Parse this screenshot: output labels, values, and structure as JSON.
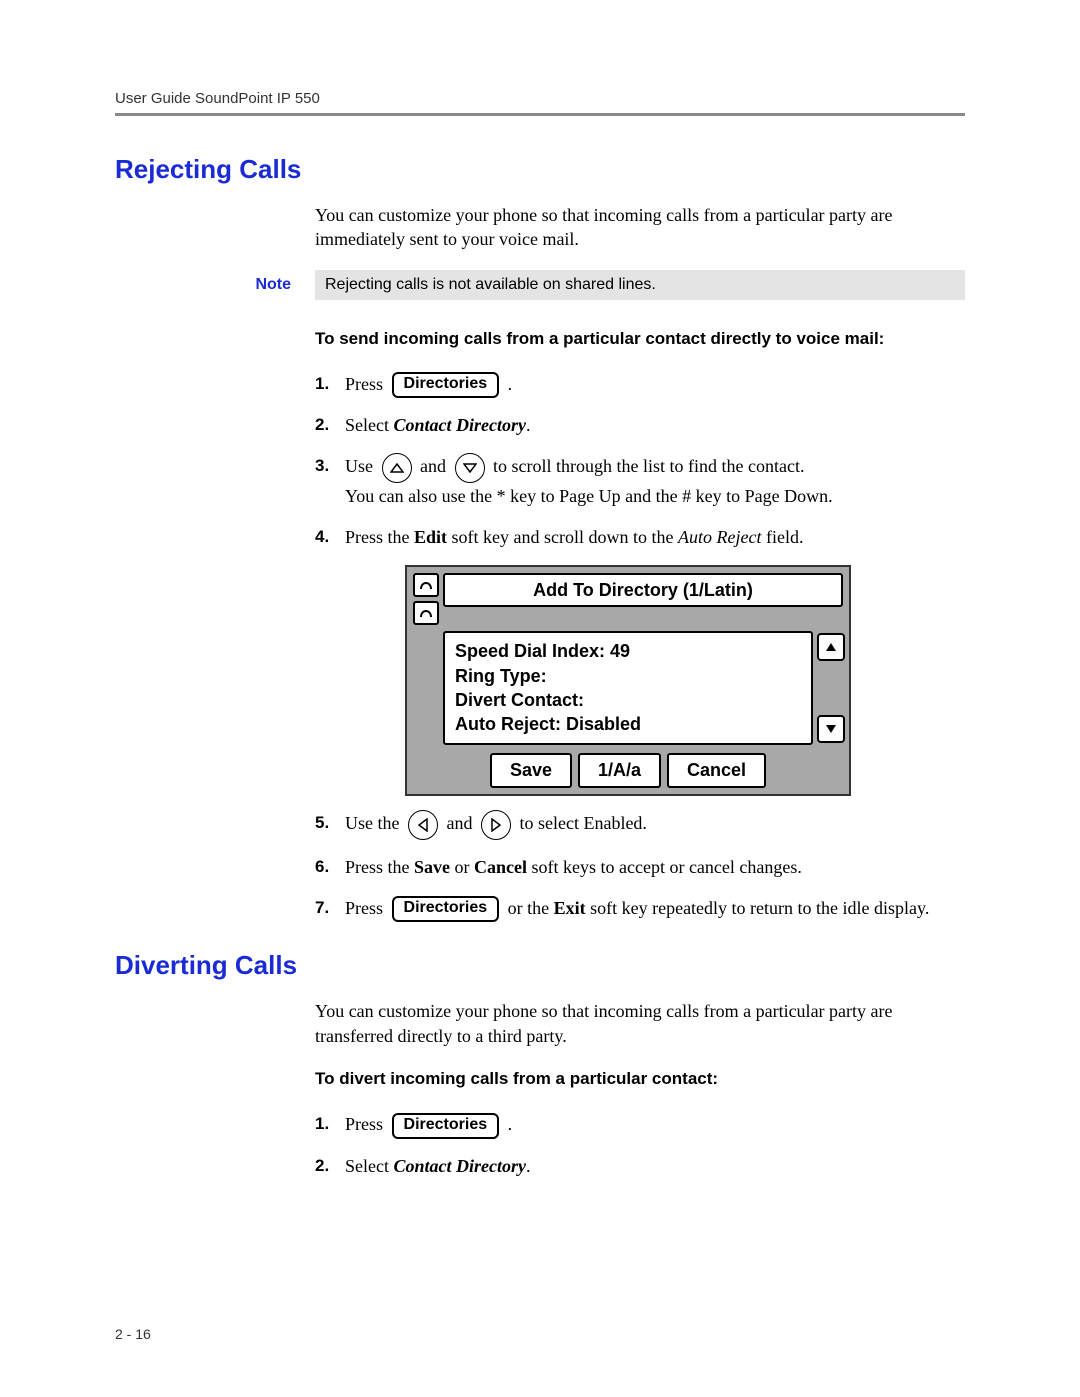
{
  "header": "User Guide SoundPoint IP 550",
  "pageNum": "2 - 16",
  "section1": {
    "title": "Rejecting Calls",
    "intro": "You can customize your phone so that incoming calls from a particular party are immediately sent to your voice mail.",
    "noteLabel": "Note",
    "noteBody": "Rejecting calls is not available on shared lines.",
    "subhead": "To send incoming calls from a particular contact directly to voice mail:",
    "step1_press": "Press ",
    "step1_btn": "Directories",
    "step1_end": " .",
    "step2_a": "Select ",
    "step2_b": "Contact Directory",
    "step2_c": ".",
    "step3_a": "Use ",
    "step3_b": " and ",
    "step3_c": " to scroll through the list to find the contact.",
    "step3_line2": "You can also use the * key to Page Up and the # key to Page Down.",
    "step4_a": "Press the ",
    "step4_b": "Edit",
    "step4_c": " soft key and scroll down to the ",
    "step4_d": "Auto Reject",
    "step4_e": " field.",
    "lcd": {
      "title": "Add To Directory (1/Latin)",
      "line1": "Speed Dial Index: 49",
      "line2": "Ring Type:",
      "line3": "Divert Contact:",
      "line4": "Auto Reject: Disabled",
      "sk1": "Save",
      "sk2": "1/A/a",
      "sk3": "Cancel"
    },
    "step5_a": "Use the ",
    "step5_b": " and ",
    "step5_c": " to select Enabled.",
    "step6_a": "Press the ",
    "step6_b": "Save",
    "step6_c": " or ",
    "step6_d": "Cancel",
    "step6_e": " soft keys to accept or cancel changes.",
    "step7_a": "Press ",
    "step7_btn": "Directories",
    "step7_b": " or the ",
    "step7_c": "Exit",
    "step7_d": " soft key repeatedly to return to the idle display."
  },
  "section2": {
    "title": "Diverting Calls",
    "intro": "You can customize your phone so that incoming calls from a particular party are transferred directly to a third party.",
    "subhead": "To divert incoming calls from a particular contact:",
    "step1_press": "Press ",
    "step1_btn": "Directories",
    "step1_end": " .",
    "step2_a": "Select ",
    "step2_b": "Contact Directory",
    "step2_c": "."
  }
}
